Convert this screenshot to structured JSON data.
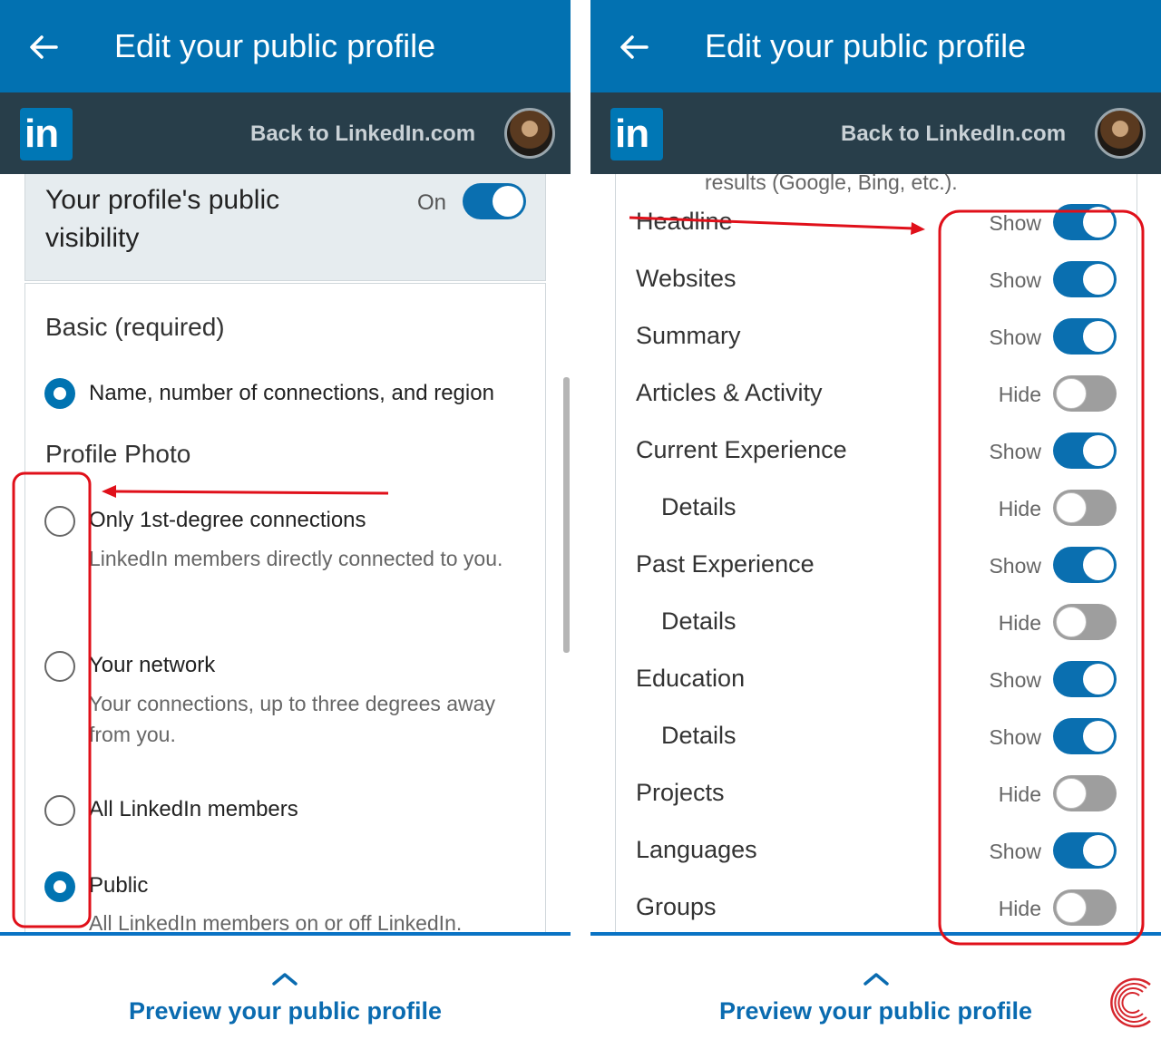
{
  "left": {
    "appbar": {
      "title": "Edit your public profile"
    },
    "header": {
      "back_link": "Back to LinkedIn.com",
      "logo_text": "in"
    },
    "visibility": {
      "title": "Your profile's public visibility",
      "state": "On",
      "toggle_on": true
    },
    "basic": {
      "label": "Basic (required)",
      "option": {
        "label": "Name, number of connections, and region",
        "checked": true
      }
    },
    "profile_photo": {
      "label": "Profile Photo",
      "options": [
        {
          "label": "Only 1st-degree connections",
          "description": "LinkedIn members directly connected to you.",
          "checked": false
        },
        {
          "label": "Your network",
          "description": "Your connections, up to three degrees away from you.",
          "checked": false
        },
        {
          "label": "All LinkedIn members",
          "description": "",
          "checked": false
        },
        {
          "label": "Public",
          "description": "All LinkedIn members on or off LinkedIn.",
          "checked": true
        }
      ]
    },
    "footer": {
      "preview": "Preview your public profile"
    }
  },
  "right": {
    "appbar": {
      "title": "Edit your public profile"
    },
    "header": {
      "back_link": "Back to LinkedIn.com",
      "logo_text": "in"
    },
    "cutoff_text": "results (Google, Bing, etc.).",
    "rows": [
      {
        "label": "Headline",
        "state": "Show",
        "on": true,
        "indent": false
      },
      {
        "label": "Websites",
        "state": "Show",
        "on": true,
        "indent": false
      },
      {
        "label": "Summary",
        "state": "Show",
        "on": true,
        "indent": false
      },
      {
        "label": "Articles & Activity",
        "state": "Hide",
        "on": false,
        "indent": false
      },
      {
        "label": "Current Experience",
        "state": "Show",
        "on": true,
        "indent": false
      },
      {
        "label": "Details",
        "state": "Hide",
        "on": false,
        "indent": true
      },
      {
        "label": "Past Experience",
        "state": "Show",
        "on": true,
        "indent": false
      },
      {
        "label": "Details",
        "state": "Hide",
        "on": false,
        "indent": true
      },
      {
        "label": "Education",
        "state": "Show",
        "on": true,
        "indent": false
      },
      {
        "label": "Details",
        "state": "Show",
        "on": true,
        "indent": true
      },
      {
        "label": "Projects",
        "state": "Hide",
        "on": false,
        "indent": false
      },
      {
        "label": "Languages",
        "state": "Show",
        "on": true,
        "indent": false
      },
      {
        "label": "Groups",
        "state": "Hide",
        "on": false,
        "indent": false
      }
    ],
    "footer": {
      "preview": "Preview your public profile"
    }
  },
  "colors": {
    "appbar": "#0271b1",
    "header": "#283e4a",
    "toggle_on": "#0a6fb0",
    "toggle_off": "#9e9e9e",
    "annotation": "#e0101a",
    "link": "#0a6bb0"
  }
}
